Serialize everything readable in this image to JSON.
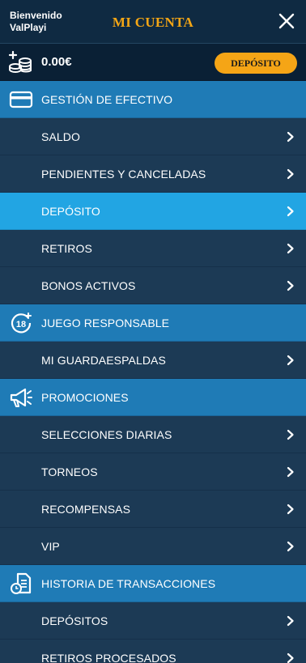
{
  "header": {
    "welcome_line1": "Bienvenido",
    "welcome_line2": "ValPlayi",
    "title": "MI CUENTA",
    "close_icon": "close-icon"
  },
  "balance": {
    "icon": "coins-plus-icon",
    "amount": "0.00€",
    "deposit_button": "DEPÓSITO"
  },
  "colors": {
    "accent": "#f5a516",
    "section_bg": "#1f7bb6",
    "item_bg": "#1c3a55",
    "active_bg": "#22a5e3"
  },
  "menu": {
    "cash": {
      "label": "GESTIÓN DE EFECTIVO",
      "icon": "credit-card-icon",
      "items": [
        "SALDO",
        "PENDIENTES Y CANCELADAS",
        "DEPÓSITO",
        "RETIROS",
        "BONOS ACTIVOS"
      ],
      "active": "DEPÓSITO"
    },
    "responsible": {
      "label": "JUEGO RESPONSABLE",
      "icon": "age-18-plus-icon",
      "items": [
        "MI GUARDAESPALDAS"
      ]
    },
    "promotions": {
      "label": "PROMOCIONES",
      "icon": "megaphone-icon",
      "items": [
        "SELECCIONES DIARIAS",
        "TORNEOS",
        "RECOMPENSAS",
        "VIP"
      ]
    },
    "history": {
      "label": "HISTORIA DE TRANSACCIONES",
      "icon": "document-clock-icon",
      "items": [
        "DEPÓSITOS",
        "RETIROS PROCESADOS"
      ]
    }
  }
}
